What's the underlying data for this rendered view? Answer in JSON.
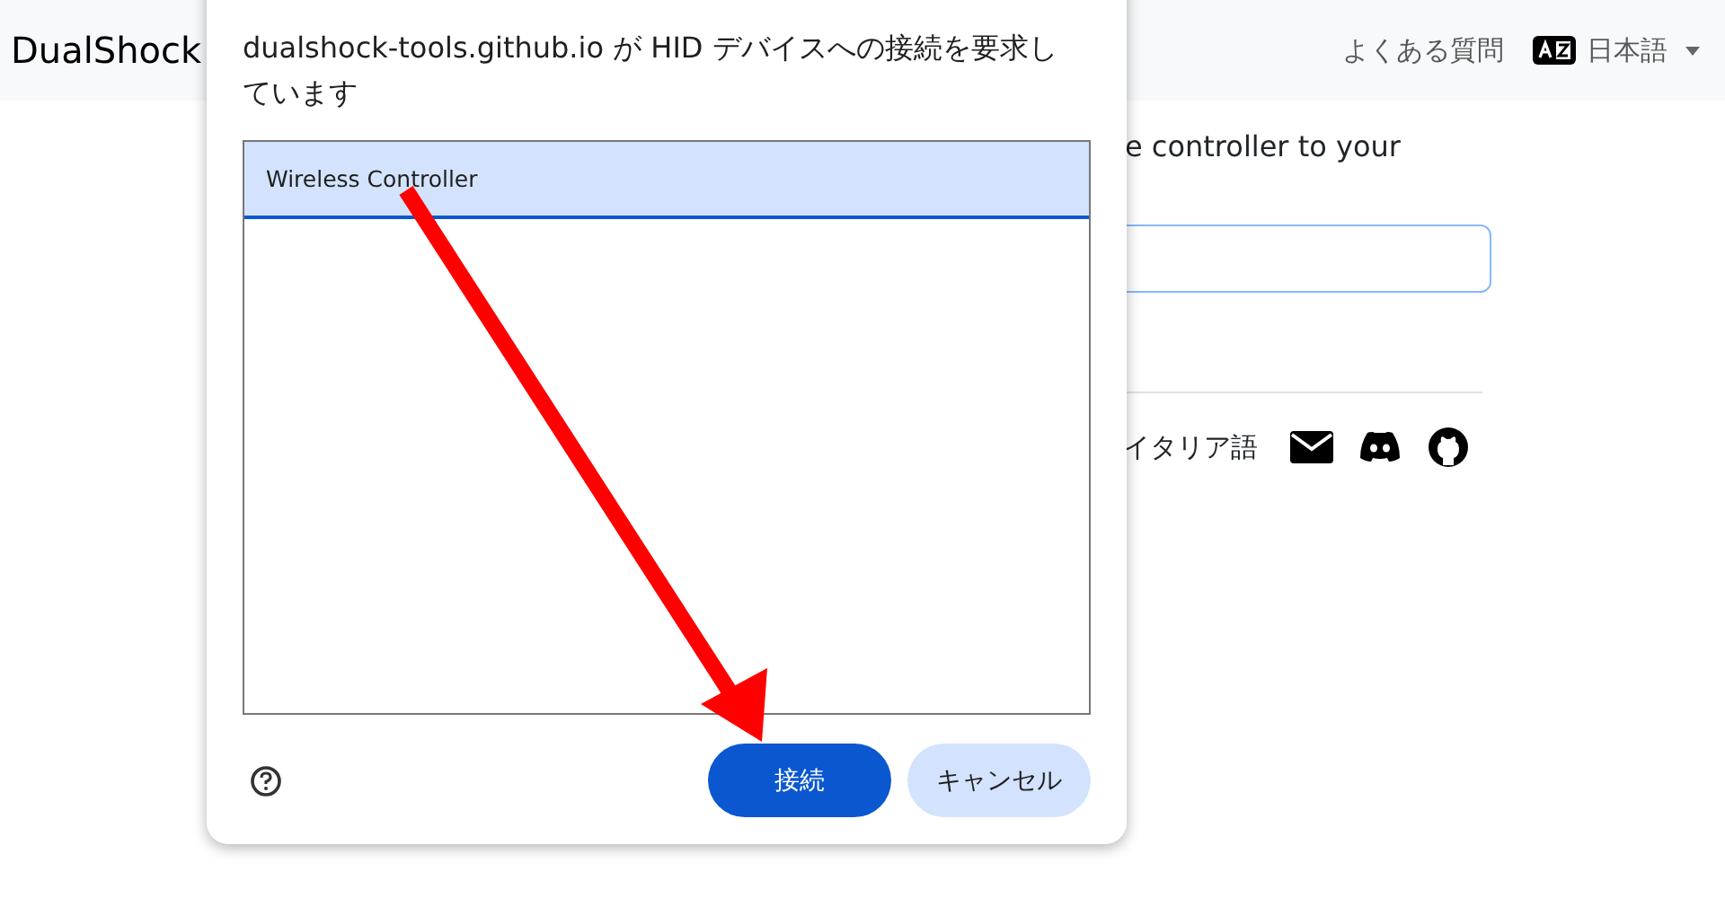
{
  "header": {
    "brand": "DualShock",
    "faq": "よくある質問",
    "language": "日本語"
  },
  "main": {
    "intro": "e controller to your",
    "language_link": "イタリア語"
  },
  "dialog": {
    "title": "dualshock-tools.github.io が HID デバイスへの接続を要求しています",
    "devices": [
      {
        "label": "Wireless Controller",
        "selected": true
      }
    ],
    "connect": "接続",
    "cancel": "キャンセル"
  }
}
